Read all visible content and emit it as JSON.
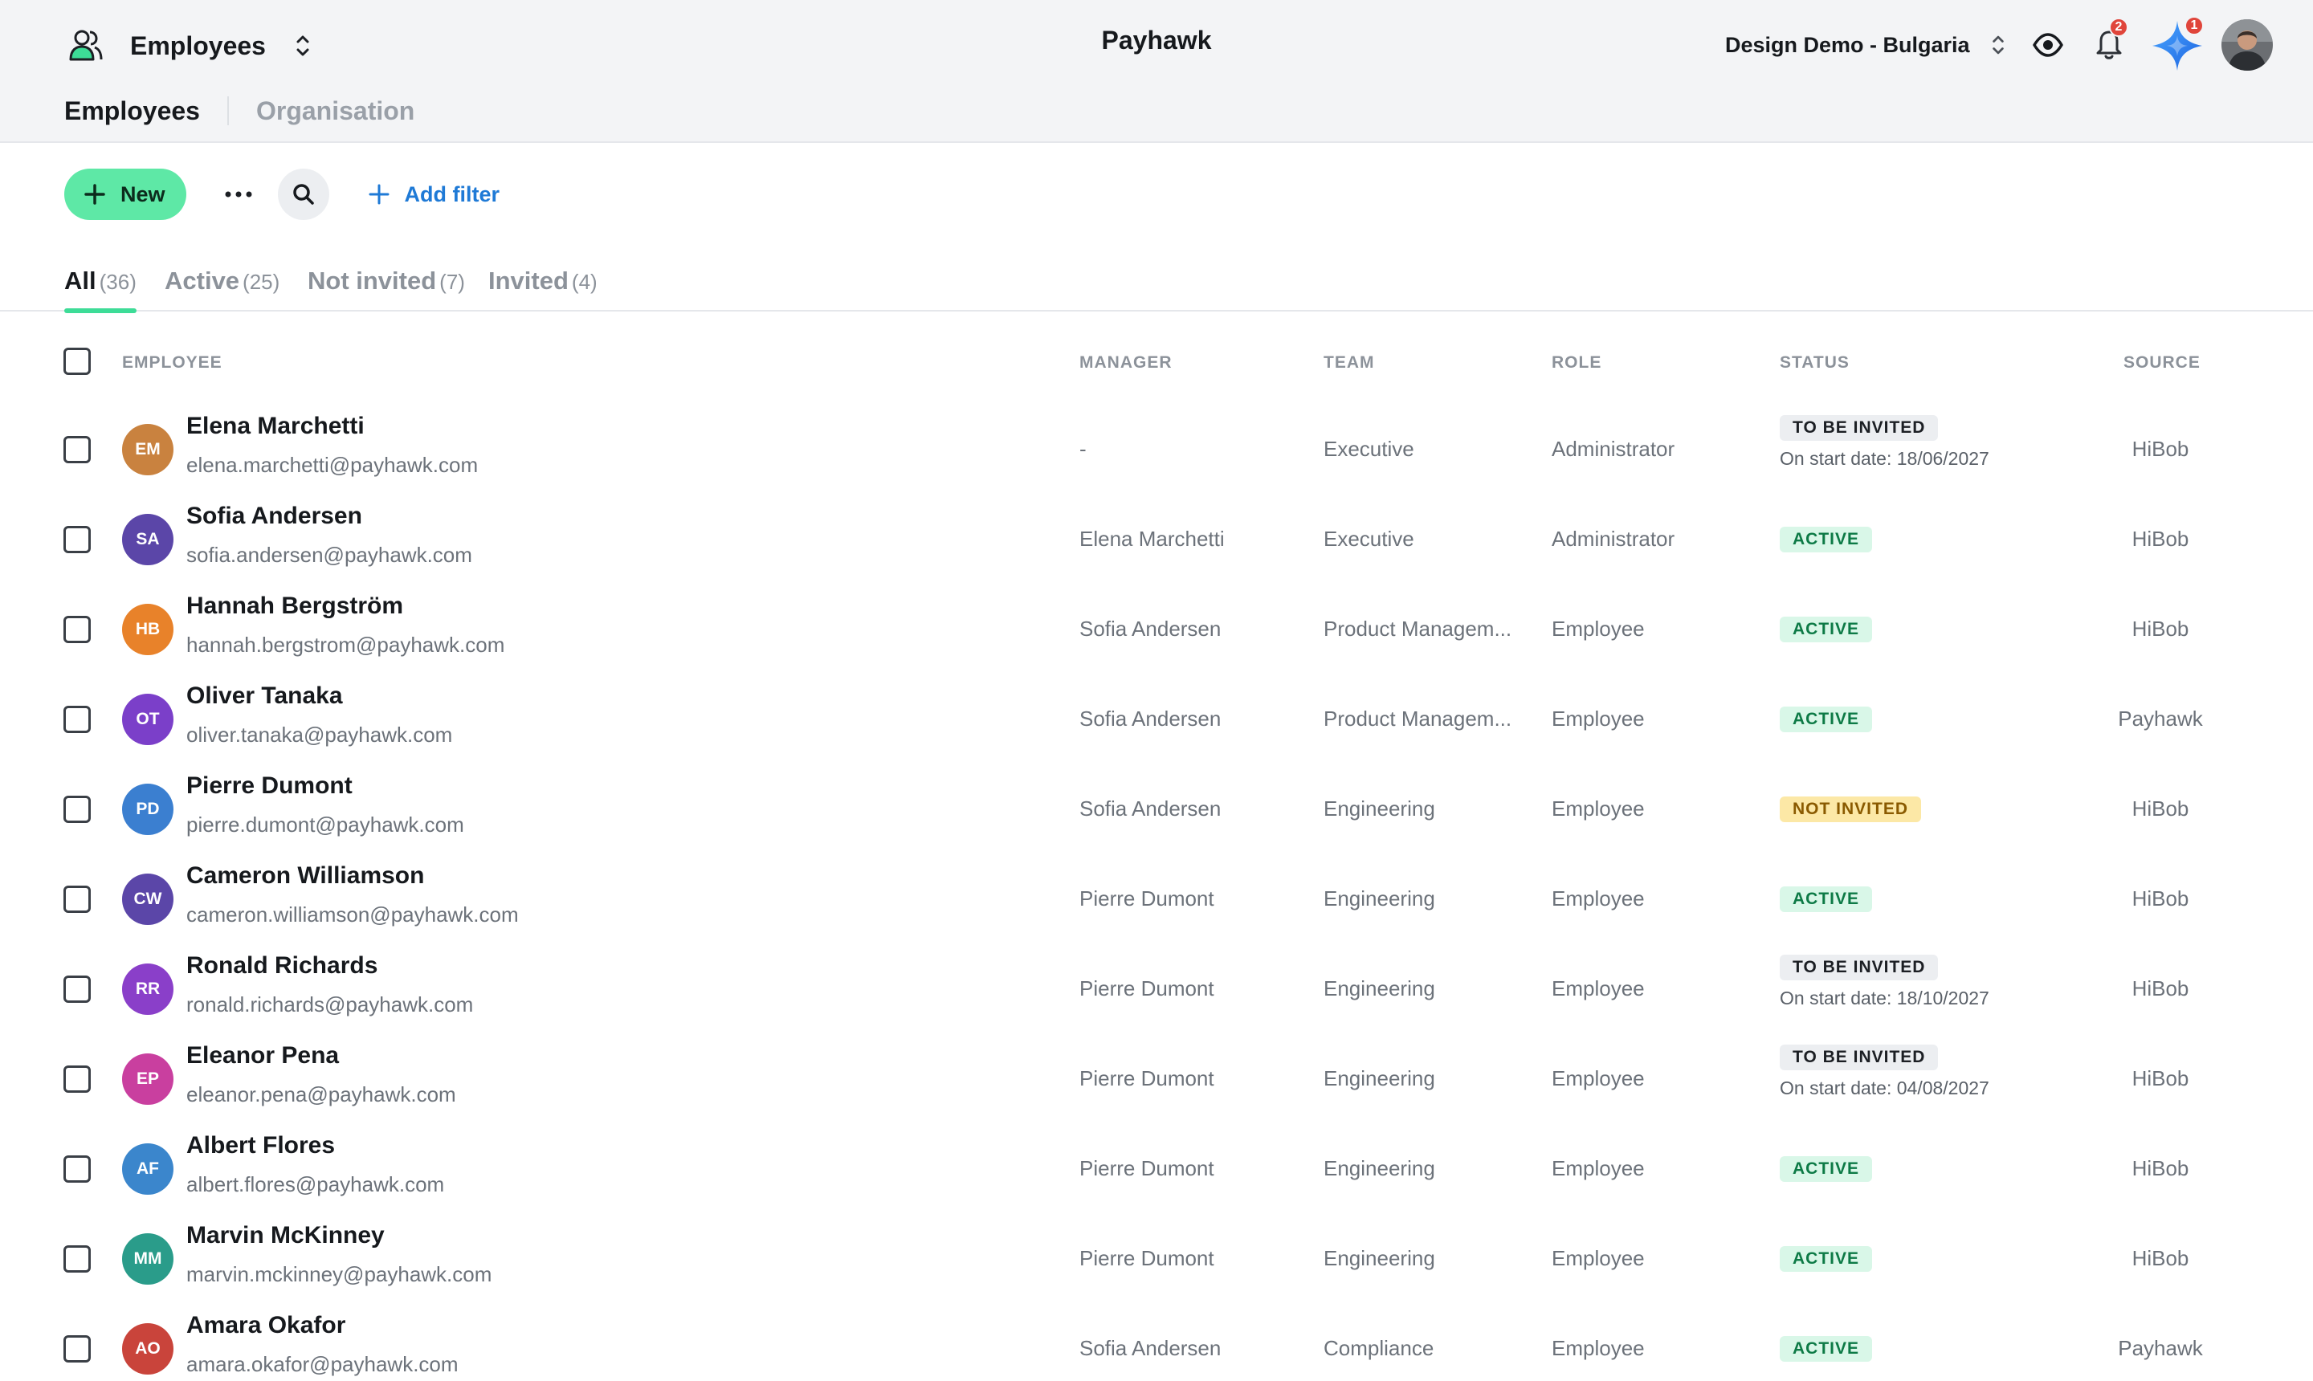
{
  "header": {
    "app_title": "Employees",
    "brand": "Payhawk",
    "company": "Design Demo - Bulgaria",
    "notifications_count": "2",
    "assistant_count": "1",
    "page_tabs": [
      "Employees",
      "Organisation"
    ]
  },
  "toolbar": {
    "new_label": "New",
    "add_filter_label": "Add filter"
  },
  "status_tabs": [
    {
      "label": "All",
      "count": "(36)"
    },
    {
      "label": "Active",
      "count": "(25)"
    },
    {
      "label": "Not invited",
      "count": "(7)"
    },
    {
      "label": "Invited",
      "count": "(4)"
    }
  ],
  "table": {
    "columns": {
      "employee": "EMPLOYEE",
      "manager": "MANAGER",
      "team": "TEAM",
      "role": "ROLE",
      "status": "STATUS",
      "source": "SOURCE"
    },
    "rows": [
      {
        "initials": "EM",
        "color": "#c9823f",
        "name": "Elena Marchetti",
        "email": "elena.marchetti@payhawk.com",
        "manager": "-",
        "team": "Executive",
        "role": "Administrator",
        "status": "TO BE INVITED",
        "status_type": "to-be-invited",
        "status_note": "On start date: 18/06/2027",
        "source": "HiBob"
      },
      {
        "initials": "SA",
        "color": "#5b46a8",
        "name": "Sofia Andersen",
        "email": "sofia.andersen@payhawk.com",
        "manager": "Elena Marchetti",
        "team": "Executive",
        "role": "Administrator",
        "status": "ACTIVE",
        "status_type": "active-pill",
        "status_note": "",
        "source": "HiBob"
      },
      {
        "initials": "HB",
        "color": "#e8822a",
        "name": "Hannah Bergström",
        "email": "hannah.bergstrom@payhawk.com",
        "manager": "Sofia Andersen",
        "team": "Product Managem...",
        "role": "Employee",
        "status": "ACTIVE",
        "status_type": "active-pill",
        "status_note": "",
        "source": "HiBob"
      },
      {
        "initials": "OT",
        "color": "#7b3fc9",
        "name": "Oliver Tanaka",
        "email": "oliver.tanaka@payhawk.com",
        "manager": "Sofia Andersen",
        "team": "Product Managem...",
        "role": "Employee",
        "status": "ACTIVE",
        "status_type": "active-pill",
        "status_note": "",
        "source": "Payhawk"
      },
      {
        "initials": "PD",
        "color": "#3b7fd0",
        "name": "Pierre Dumont",
        "email": "pierre.dumont@payhawk.com",
        "manager": "Sofia Andersen",
        "team": "Engineering",
        "role": "Employee",
        "status": "NOT INVITED",
        "status_type": "not-invited",
        "status_note": "",
        "source": "HiBob"
      },
      {
        "initials": "CW",
        "color": "#5b46a8",
        "name": "Cameron Williamson",
        "email": "cameron.williamson@payhawk.com",
        "manager": "Pierre Dumont",
        "team": "Engineering",
        "role": "Employee",
        "status": "ACTIVE",
        "status_type": "active-pill",
        "status_note": "",
        "source": "HiBob"
      },
      {
        "initials": "RR",
        "color": "#8a3fc9",
        "name": "Ronald Richards",
        "email": "ronald.richards@payhawk.com",
        "manager": "Pierre Dumont",
        "team": "Engineering",
        "role": "Employee",
        "status": "TO BE INVITED",
        "status_type": "to-be-invited",
        "status_note": "On start date: 18/10/2027",
        "source": "HiBob"
      },
      {
        "initials": "EP",
        "color": "#c93f9f",
        "name": "Eleanor Pena",
        "email": "eleanor.pena@payhawk.com",
        "manager": "Pierre Dumont",
        "team": "Engineering",
        "role": "Employee",
        "status": "TO BE INVITED",
        "status_type": "to-be-invited",
        "status_note": "On start date: 04/08/2027",
        "source": "HiBob"
      },
      {
        "initials": "AF",
        "color": "#3b86cc",
        "name": "Albert Flores",
        "email": "albert.flores@payhawk.com",
        "manager": "Pierre Dumont",
        "team": "Engineering",
        "role": "Employee",
        "status": "ACTIVE",
        "status_type": "active-pill",
        "status_note": "",
        "source": "HiBob"
      },
      {
        "initials": "MM",
        "color": "#2a9c8a",
        "name": "Marvin McKinney",
        "email": "marvin.mckinney@payhawk.com",
        "manager": "Pierre Dumont",
        "team": "Engineering",
        "role": "Employee",
        "status": "ACTIVE",
        "status_type": "active-pill",
        "status_note": "",
        "source": "HiBob"
      },
      {
        "initials": "AO",
        "color": "#c9443b",
        "name": "Amara Okafor",
        "email": "amara.okafor@payhawk.com",
        "manager": "Sofia Andersen",
        "team": "Compliance",
        "role": "Employee",
        "status": "ACTIVE",
        "status_type": "active-pill",
        "status_note": "",
        "source": "Payhawk"
      }
    ]
  }
}
